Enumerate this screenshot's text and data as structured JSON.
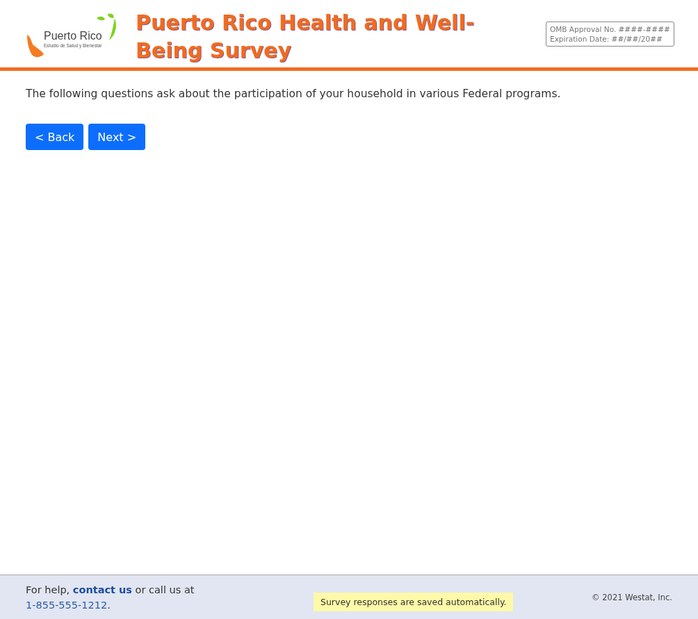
{
  "logo": {
    "name": "Puerto Rico",
    "tagline": "Estudio de Salud y Bienestar"
  },
  "header": {
    "title": "Puerto Rico Health and Well-Being Survey",
    "omb": [
      "OMB Approval No. ####-####",
      "Expiration Date: ##/##/20##"
    ]
  },
  "intro": "The following questions ask about the participation of your household in various Federal programs.",
  "buttons": [
    "< Back",
    "Next >"
  ],
  "footer": {
    "help_before": "For help, ",
    "help_link": "contact us",
    "help_middle": " or call us at ",
    "phone": "1-855-555-1212",
    "help_after": ".",
    "notice": "Survey responses are saved automatically.",
    "copyright": "© 2021 Westat, Inc."
  }
}
